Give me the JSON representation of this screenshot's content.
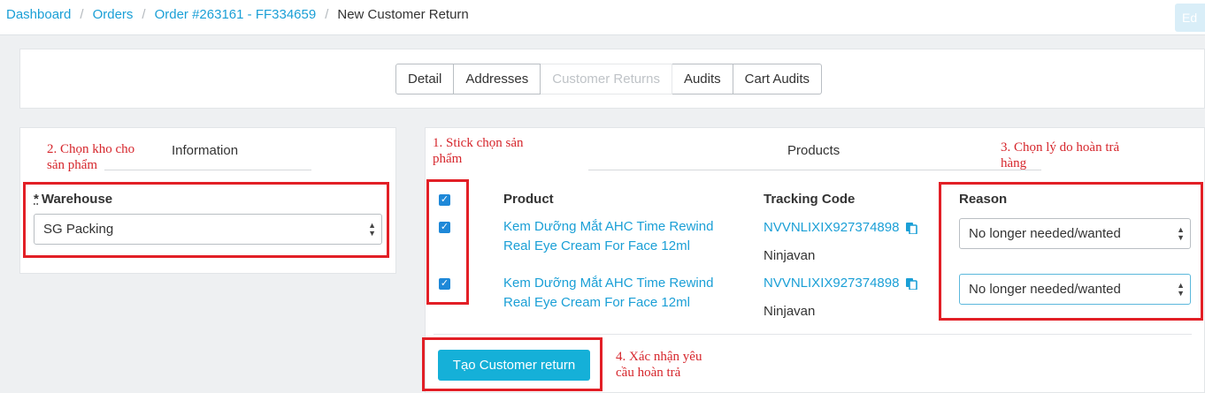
{
  "breadcrumb": {
    "items": [
      "Dashboard",
      "Orders",
      "Order #263161 - FF334659"
    ],
    "current": "New Customer Return",
    "separator": "/"
  },
  "header": {
    "edit_label": "Ed"
  },
  "tabs": [
    {
      "label": "Detail",
      "active": false
    },
    {
      "label": "Addresses",
      "active": false
    },
    {
      "label": "Customer Returns",
      "active": true
    },
    {
      "label": "Audits",
      "active": false
    },
    {
      "label": "Cart Audits",
      "active": false
    }
  ],
  "information": {
    "title": "Information",
    "warehouse_required_mark": "*",
    "warehouse_label": "Warehouse",
    "warehouse_value": "SG Packing"
  },
  "products": {
    "title": "Products",
    "columns": {
      "product": "Product",
      "tracking": "Tracking Code",
      "reason": "Reason"
    },
    "rows": [
      {
        "checked": true,
        "name_line1": "Kem Dưỡng Mắt AHC Time Rewind",
        "name_line2": "Real Eye Cream For Face 12ml",
        "tracking_code": "NVVNLIXIX927374898",
        "carrier": "Ninjavan",
        "reason": "No longer needed/wanted"
      },
      {
        "checked": true,
        "name_line1": "Kem Dưỡng Mắt AHC Time Rewind",
        "name_line2": "Real Eye Cream For Face 12ml",
        "tracking_code": "NVVNLIXIX927374898",
        "carrier": "Ninjavan",
        "reason": "No longer needed/wanted"
      }
    ]
  },
  "actions": {
    "create_return_label": "Tạo Customer return"
  },
  "annotations": {
    "step1_line1": "1. Stick chọn sản",
    "step1_line2": "phẩm",
    "step2_line1": "2. Chọn kho cho",
    "step2_line2": "sản phẩm",
    "step3_line1": "3. Chọn lý do hoàn trả",
    "step3_line2": "hàng",
    "step4_line1": "4. Xác nhận yêu",
    "step4_line2": "cầu hoàn trả"
  },
  "colors": {
    "link": "#1a9fd6",
    "primary_button": "#15b0d8",
    "checkbox": "#1e88d8",
    "annotation_red": "#e21f26"
  },
  "icons": {
    "copy": "copy-icon",
    "select_caret": "select-caret-icon",
    "checkbox": "checkmark-icon"
  }
}
